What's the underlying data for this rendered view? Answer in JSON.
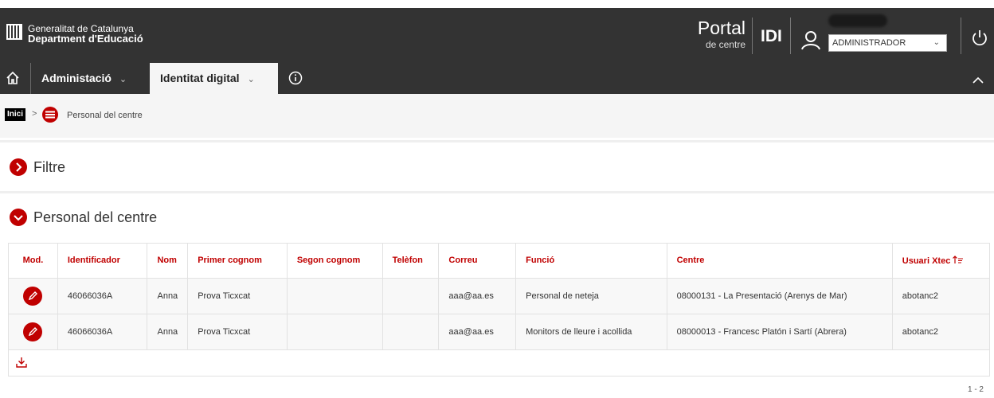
{
  "header": {
    "org_name": "Generalitat de Catalunya",
    "dept_name": "Department d'Educació",
    "portal_title": "Portal",
    "portal_subtitle": "de centre",
    "app_code": "IDI",
    "role_selected": "ADMINISTRADOR",
    "icons": [
      "generalitat-logo-icon",
      "user-icon",
      "chevron-down-icon",
      "power-icon"
    ]
  },
  "nav": {
    "items": [
      {
        "label": "Administació"
      },
      {
        "label": "Identitat digital",
        "active": true
      }
    ],
    "icons": [
      "home-icon",
      "info-icon",
      "collapse-up-icon"
    ]
  },
  "breadcrumb": {
    "home": "Inici",
    "separator": ">",
    "current": "Personal del centre"
  },
  "sections": {
    "filter_title": "Filtre",
    "list_title": "Personal del centre"
  },
  "table": {
    "columns": [
      "Mod.",
      "Identificador",
      "Nom",
      "Primer cognom",
      "Segon cognom",
      "Telèfon",
      "Correu",
      "Funció",
      "Centre",
      "Usuari Xtec"
    ],
    "rows": [
      {
        "identificador": "46066036A",
        "nom": "Anna",
        "primer_cognom": "Prova Ticxcat",
        "segon_cognom": "",
        "telefon": "",
        "correu": "aaa@aa.es",
        "funcio": "Personal de neteja",
        "centre": "08000131 - La Presentació (Arenys de Mar)",
        "usuari_xtec": "abotanc2"
      },
      {
        "identificador": "46066036A",
        "nom": "Anna",
        "primer_cognom": "Prova Ticxcat",
        "segon_cognom": "",
        "telefon": "",
        "correu": "aaa@aa.es",
        "funcio": "Monitors de lleure i acollida",
        "centre": "08000013 - Francesc Platón i Sartí (Abrera)",
        "usuari_xtec": "abotanc2"
      }
    ],
    "pagination": "1 - 2"
  },
  "colors": {
    "accent": "#c00000",
    "header_bg": "#333333",
    "breadcrumb_bg": "#f5f5f5"
  }
}
